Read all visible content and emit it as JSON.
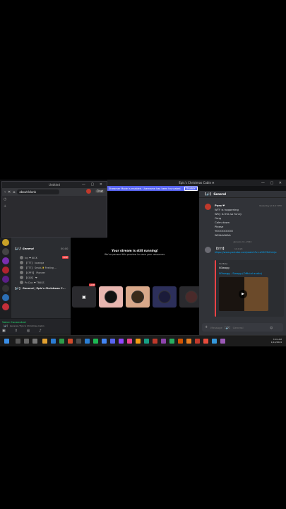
{
  "browser": {
    "window_title": "Untitled",
    "url": "about:blank",
    "chat_button": "Chat"
  },
  "discord": {
    "window_title": "Epic's Christmas Cabin ❄",
    "banner_text": "Streamer Mode is enabled. Username has been truncated.",
    "banner_button": "Disable",
    "channel_header": "【🔊】 General",
    "voice_channel_name": "【🔊】 General",
    "voice_elapsed": "00:00",
    "live_badge": "LIVE",
    "voice_users": [
      {
        "name": "Ivy ❤ KICK"
      },
      {
        "name": "【TTT】 lusanga"
      },
      {
        "name": "【TTT】 Smok✨ Feeling ..."
      },
      {
        "name": "【XPFE】 Pioneer"
      },
      {
        "name": "【XXX】 ❤"
      },
      {
        "name": "Pv Duc ❤ TRASS"
      }
    ],
    "voice_connected": {
      "status": "Voice Connected",
      "subtitle": "【🔊】 General / Epic's Christmas Cabin"
    },
    "voice_item": "【🔊】 General | Epic's Christmas C...",
    "user_panel": {
      "name": "H...",
      "status": "Sharing Entire screen"
    },
    "stream": {
      "message": "Your stream is still running!",
      "submessage": "We've paused this preview to save your resources."
    },
    "chat": {
      "messages": [
        {
          "author": "Pyro ❤",
          "time": "Yesterday at 6:27 PM",
          "lines": [
            "WTF is happening",
            "Why is this so funny",
            "Omg",
            "Calm down",
            "Please",
            "YOOOOOOOO",
            "WHAAAAAA"
          ]
        }
      ],
      "date_divider": "January 11, 2024",
      "second_author": "【TTT】",
      "second_time": "1/11/24",
      "link": "https://www.youtube.com/watch?v=zG9O3kHnhJo",
      "embed": {
        "provider": "YouTube",
        "author": "N3wagg",
        "title": "N3wagg - Swagg (Official audio)"
      },
      "input_placeholder": "Message 【🔊】 General"
    }
  },
  "taskbar": {
    "time": "3:01 AM",
    "date": "1/14/2024"
  },
  "colors": {
    "blurple": "#5865f2",
    "live_red": "#ed4245",
    "voice_green": "#23a55a",
    "link_blue": "#00a8fc"
  }
}
